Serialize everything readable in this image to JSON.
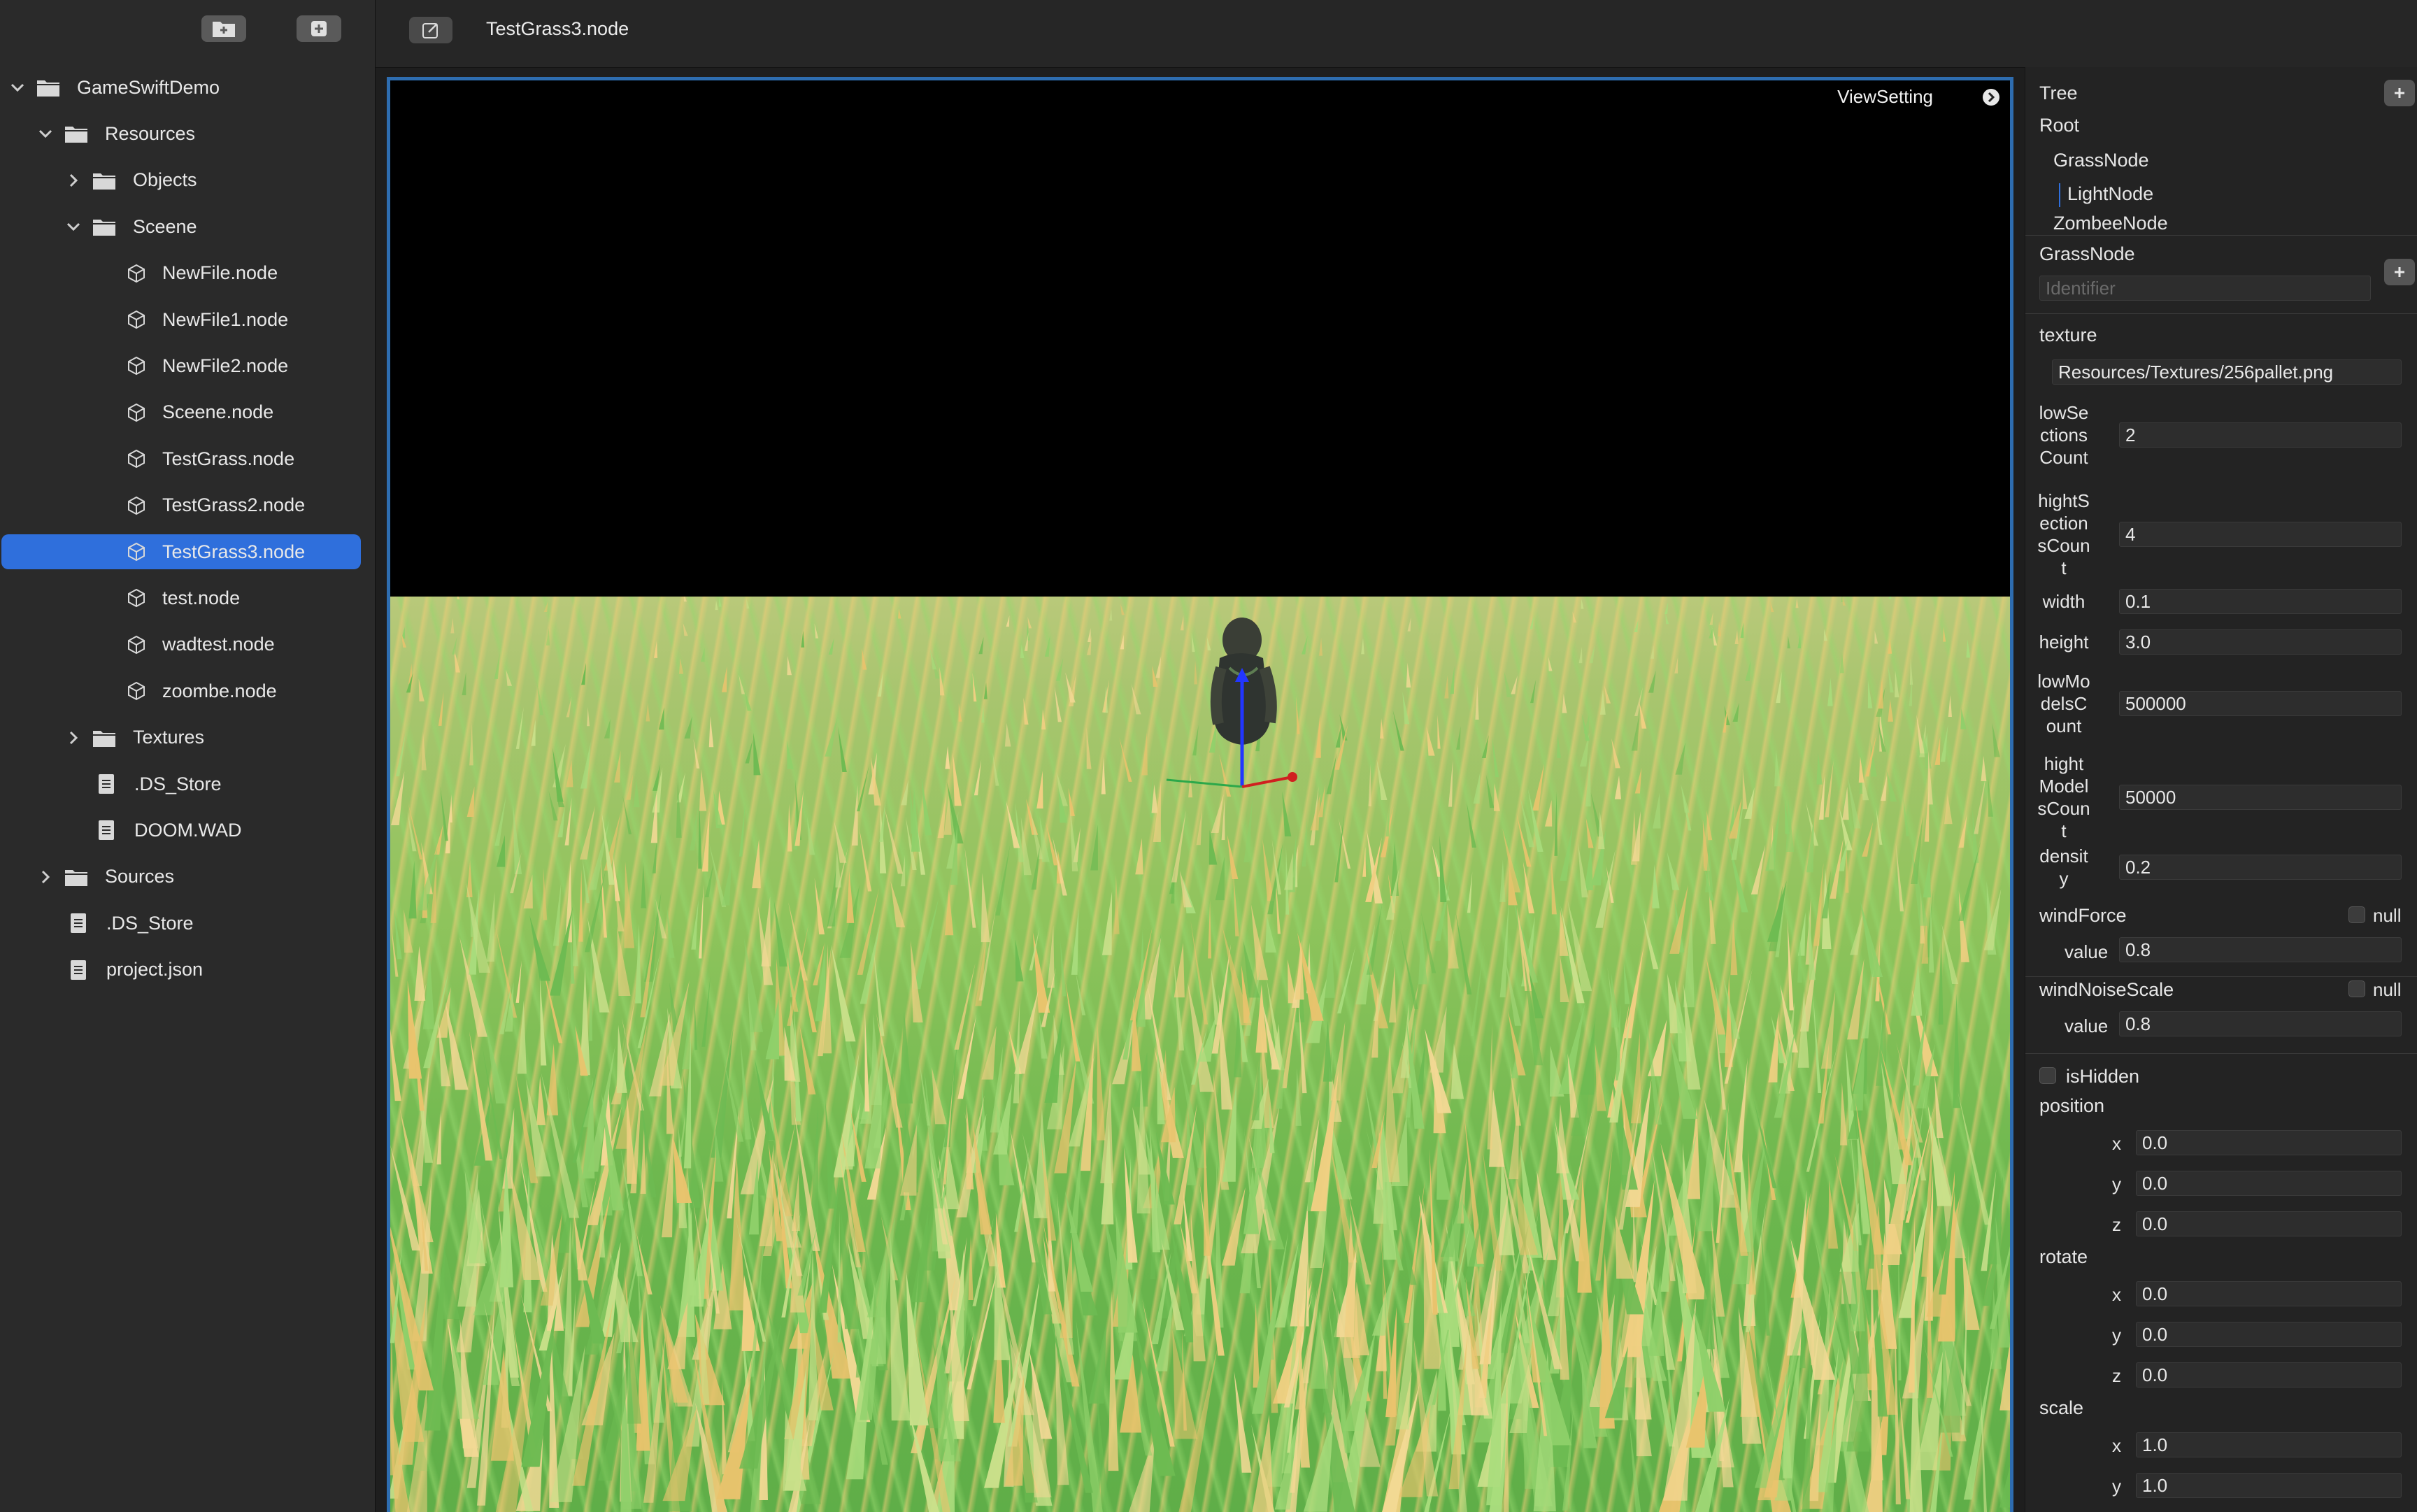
{
  "sidebar": {
    "toolbar": {
      "new_folder_icon": "folder-plus-icon",
      "add_icon": "plus-square-icon"
    },
    "items": [
      {
        "label": "GameSwiftDemo",
        "depth": 0,
        "kind": "folder",
        "chevron": "down"
      },
      {
        "label": "Resources",
        "depth": 1,
        "kind": "folder",
        "chevron": "down"
      },
      {
        "label": "Objects",
        "depth": 2,
        "kind": "folder",
        "chevron": "right"
      },
      {
        "label": "Sceene",
        "depth": 2,
        "kind": "folder",
        "chevron": "down"
      },
      {
        "label": "NewFile.node",
        "depth": 3,
        "kind": "node"
      },
      {
        "label": "NewFile1.node",
        "depth": 3,
        "kind": "node"
      },
      {
        "label": "NewFile2.node",
        "depth": 3,
        "kind": "node"
      },
      {
        "label": "Sceene.node",
        "depth": 3,
        "kind": "node"
      },
      {
        "label": "TestGrass.node",
        "depth": 3,
        "kind": "node"
      },
      {
        "label": "TestGrass2.node",
        "depth": 3,
        "kind": "node"
      },
      {
        "label": "TestGrass3.node",
        "depth": 3,
        "kind": "node",
        "selected": true
      },
      {
        "label": "test.node",
        "depth": 3,
        "kind": "node"
      },
      {
        "label": "wadtest.node",
        "depth": 3,
        "kind": "node"
      },
      {
        "label": "zoombe.node",
        "depth": 3,
        "kind": "node"
      },
      {
        "label": "Textures",
        "depth": 2,
        "kind": "folder",
        "chevron": "right"
      },
      {
        "label": ".DS_Store",
        "depth": 2,
        "kind": "file"
      },
      {
        "label": "DOOM.WAD",
        "depth": 2,
        "kind": "file"
      },
      {
        "label": "Sources",
        "depth": 1,
        "kind": "folder",
        "chevron": "right"
      },
      {
        "label": ".DS_Store",
        "depth": 1,
        "kind": "file"
      },
      {
        "label": "project.json",
        "depth": 1,
        "kind": "file"
      }
    ]
  },
  "topbar": {
    "title": "TestGrass3.node",
    "edit_icon": "edit-icon"
  },
  "viewport": {
    "view_setting_label": "ViewSetting",
    "accent": "#2e6db0"
  },
  "inspector": {
    "tree_header": "Tree",
    "tree": {
      "root": "Root",
      "nodes": [
        "GrassNode",
        "LightNode",
        "ZombeeNode"
      ]
    },
    "node_title": "GrassNode",
    "identifier_placeholder": "Identifier",
    "texture_label": "texture",
    "texture_value": "Resources/Textures/256pallet.png",
    "props": [
      {
        "label": "lowSe\nctions\nCount",
        "value": "2"
      },
      {
        "label": "hightS\nection\nsCoun\nt",
        "value": "4"
      },
      {
        "label": "width",
        "value": "0.1"
      },
      {
        "label": "height",
        "value": "3.0"
      },
      {
        "label": "lowMo\ndelsC\nount",
        "value": "500000"
      },
      {
        "label": "hight\nModel\nsCoun\nt",
        "value": "50000"
      },
      {
        "label": "densit\ny",
        "value": "0.2"
      }
    ],
    "wind_force": {
      "label": "windForce",
      "null_label": "null",
      "value_label": "value",
      "value": "0.8"
    },
    "wind_noise": {
      "label": "windNoiseScale",
      "null_label": "null",
      "value_label": "value",
      "value": "0.8"
    },
    "is_hidden_label": "isHidden",
    "position": {
      "label": "position",
      "x": "0.0",
      "y": "0.0",
      "z": "0.0"
    },
    "rotate": {
      "label": "rotate",
      "x": "0.0",
      "y": "0.0",
      "z": "0.0"
    },
    "scale": {
      "label": "scale",
      "x": "1.0",
      "y": "1.0"
    },
    "axis_labels": {
      "x": "x",
      "y": "y",
      "z": "z"
    }
  }
}
